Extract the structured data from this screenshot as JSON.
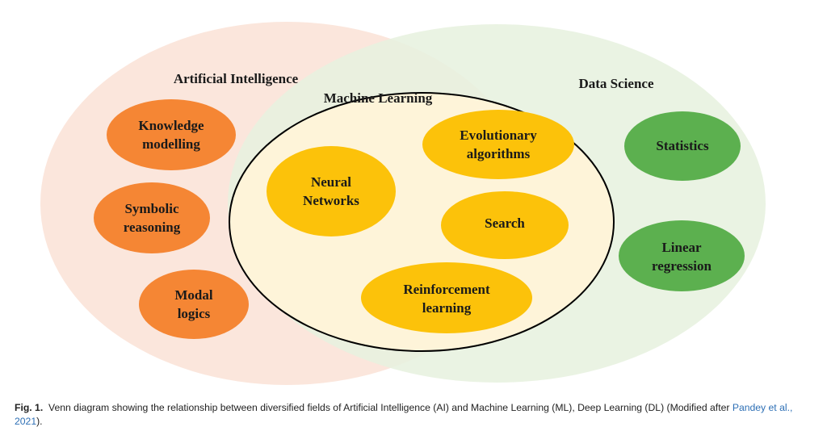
{
  "diagram": {
    "sets": {
      "ai": {
        "label": "Artificial Intelligence",
        "color": "#fbe6dc"
      },
      "ds": {
        "label": "Data Science",
        "color": "#e7f1df"
      },
      "ml": {
        "label": "Machine Learning",
        "color": "#fef4d9"
      }
    },
    "ai_topics": [
      {
        "line1": "Knowledge",
        "line2": "modelling"
      },
      {
        "line1": "Symbolic",
        "line2": "reasoning"
      },
      {
        "line1": "Modal",
        "line2": "logics"
      }
    ],
    "ml_topics": [
      {
        "line1": "Neural",
        "line2": "Networks"
      },
      {
        "line1": "Evolutionary",
        "line2": "algorithms"
      },
      {
        "line1": "Search",
        "line2": ""
      },
      {
        "line1": "Reinforcement",
        "line2": "learning"
      }
    ],
    "ds_topics": [
      {
        "line1": "Statistics",
        "line2": ""
      },
      {
        "line1": "Linear",
        "line2": "regression"
      }
    ],
    "colors": {
      "ai_topic": "#f58634",
      "ml_topic": "#fcc20a",
      "ds_topic": "#5cb04f",
      "ml_border": "#000000"
    }
  },
  "caption": {
    "label": "Fig. 1.",
    "text": "Venn diagram showing the relationship between diversified fields of Artificial Intelligence (AI) and Machine Learning (ML), Deep Learning (DL) (Modified after ",
    "link": "Pandey et al., 2021",
    "end": ")."
  }
}
